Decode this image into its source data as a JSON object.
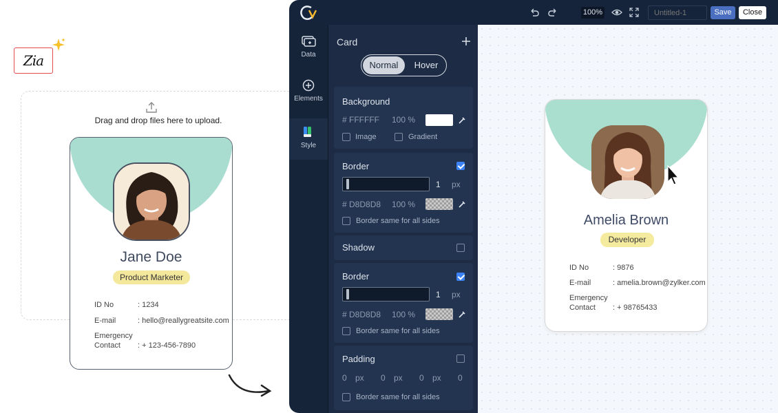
{
  "logo": {
    "text": "Zia"
  },
  "upload": {
    "text": "Drag and drop files here to upload."
  },
  "card_original": {
    "name": "Jane Doe",
    "role": "Product Marketer",
    "fields": [
      {
        "label": "ID No",
        "value": ": 1234"
      },
      {
        "label": "E-mail",
        "value": ": hello@reallygreatsite.com"
      },
      {
        "label": "Emergency\nContact",
        "value": ": + 123-456-7890"
      }
    ]
  },
  "editor": {
    "toolbar": {
      "zoom": "100%",
      "title_placeholder": "Untitled-1",
      "save_label": "Save",
      "close_label": "Close"
    },
    "rail": [
      {
        "label": "Data",
        "icon": "data-icon"
      },
      {
        "label": "Elements",
        "icon": "plus-circle-icon"
      },
      {
        "label": "Style",
        "icon": "style-icon"
      }
    ],
    "panel": {
      "title": "Card",
      "tabs": [
        "Normal",
        "Hover"
      ],
      "background": {
        "title": "Background",
        "color": "# FFFFFF",
        "opacity": "100 %",
        "swatch": "#FFFFFF",
        "image_label": "Image",
        "gradient_label": "Gradient"
      },
      "border1": {
        "title": "Border",
        "width": "1",
        "unit": "px",
        "color": "# D8D8D8",
        "opacity": "100 %",
        "same_sides": "Border same for all sides",
        "checked": true
      },
      "shadow": {
        "title": "Shadow",
        "checked": false
      },
      "border2": {
        "title": "Border",
        "width": "1",
        "unit": "px",
        "color": "# D8D8D8",
        "opacity": "100 %",
        "same_sides": "Border same for all sides",
        "checked": true
      },
      "padding": {
        "title": "Padding",
        "values": [
          "0",
          "0",
          "0",
          "0"
        ],
        "unit": "px",
        "same_sides": "Border same for all sides",
        "checked": false
      }
    }
  },
  "card_preview": {
    "name": "Amelia Brown",
    "role": "Developer",
    "fields": [
      {
        "label": "ID No",
        "value": ": 9876"
      },
      {
        "label": "E-mail",
        "value": ": amelia.brown@zylker.com"
      },
      {
        "label": "Emergency\nContact",
        "value": ": + 98765433"
      }
    ]
  },
  "colors": {
    "accent_teal": "#A8DDD0",
    "badge_yellow": "#F3E89C",
    "editor_dark": "#15243A",
    "save_blue": "#4A6FC0"
  }
}
